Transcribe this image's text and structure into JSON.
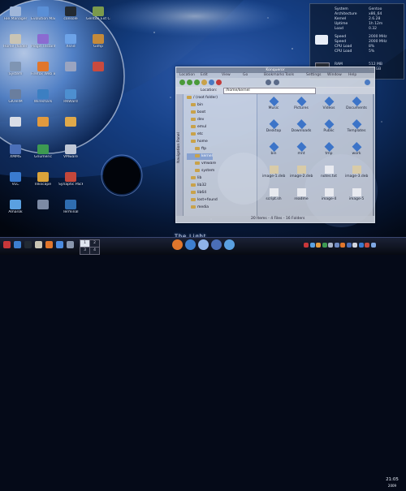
{
  "wallpaper_brand": "The Light",
  "desktop_icons": [
    {
      "label": "File Manager",
      "color": "#9fb6d9",
      "col": 0,
      "row": 0
    },
    {
      "label": "Evolution Mail",
      "color": "#5a8fd6",
      "col": 1,
      "row": 0
    },
    {
      "label": "console",
      "color": "#222a33",
      "col": 2,
      "row": 0
    },
    {
      "label": "Gentoo Ext Config",
      "color": "#7b9a4c",
      "col": 3,
      "row": 0
    },
    {
      "label": "Home (folder)",
      "color": "#c9c4b4",
      "col": 0,
      "row": 1
    },
    {
      "label": "Pidgin Instant Msgr",
      "color": "#8b6bd1",
      "col": 1,
      "row": 1
    },
    {
      "label": "Xsnd",
      "color": "#6da3e8",
      "col": 2,
      "row": 1
    },
    {
      "label": "Gimp",
      "color": "#c58a3a",
      "col": 3,
      "row": 1
    },
    {
      "label": "System",
      "color": "#7f95b3",
      "col": 0,
      "row": 2
    },
    {
      "label": "Firefox Web Browser",
      "color": "#e0762c",
      "col": 1,
      "row": 2
    },
    {
      "label": "",
      "color": "#9aa4c0",
      "col": 2,
      "row": 2
    },
    {
      "label": "",
      "color": "#c94a3e",
      "col": 3,
      "row": 2
    },
    {
      "label": "GKrellM",
      "color": "#6a7e9e",
      "col": 0,
      "row": 3
    },
    {
      "label": "Wireshark",
      "color": "#3c7fc2",
      "col": 1,
      "row": 3
    },
    {
      "label": "RKWard",
      "color": "#4d8fd0",
      "col": 2,
      "row": 3
    },
    {
      "label": "",
      "color": "#d9dde6",
      "col": 0,
      "row": 4
    },
    {
      "label": "",
      "color": "#e29a3e",
      "col": 1,
      "row": 4
    },
    {
      "label": "",
      "color": "#e0a94a",
      "col": 2,
      "row": 4
    },
    {
      "label": "XMMS",
      "color": "#4b6fb8",
      "col": 0,
      "row": 5
    },
    {
      "label": "Gnumeric",
      "color": "#3d9a52",
      "col": 1,
      "row": 5
    },
    {
      "label": "VMware",
      "color": "#bfc7d6",
      "col": 2,
      "row": 5
    },
    {
      "label": "VLC",
      "color": "#3a7bd0",
      "col": 0,
      "row": 6
    },
    {
      "label": "Inkscape",
      "color": "#d9a23a",
      "col": 1,
      "row": 6
    },
    {
      "label": "Synaptic Package Mgr",
      "color": "#c3473b",
      "col": 2,
      "row": 6
    },
    {
      "label": "Amarok",
      "color": "#5aa0e0",
      "col": 0,
      "row": 7
    },
    {
      "label": "",
      "color": "#7c8aa4",
      "col": 1,
      "row": 7
    },
    {
      "label": "Terminal",
      "color": "#2f6db0",
      "col": 2,
      "row": 7
    }
  ],
  "conky": {
    "rows": [
      {
        "label": "System",
        "value": "Gentoo"
      },
      {
        "label": "Architecture",
        "value": "x86_64"
      },
      {
        "label": "Kernel",
        "value": "2.6.28"
      },
      {
        "label": "Uptime",
        "value": "1h 12m"
      },
      {
        "label": "Load",
        "value": "0.32"
      }
    ],
    "cpu_rows": [
      {
        "label": "Speed",
        "value": "2000 MHz"
      },
      {
        "label": "Speed",
        "value": "2000 MHz"
      },
      {
        "label": "CPU Load",
        "value": "8%"
      },
      {
        "label": "CPU Load",
        "value": "5%"
      }
    ],
    "ram_rows": [
      {
        "label": "RAM",
        "value": "512 MB"
      },
      {
        "label": "Free",
        "value": "1.2 GB"
      }
    ]
  },
  "file_manager": {
    "title": "Konqueror",
    "menu": [
      "Location",
      "Edit",
      "View",
      "Go",
      "Bookmarks",
      "Tools",
      "Settings",
      "Window",
      "Help"
    ],
    "location_label": "Location:",
    "location_value": "/home/kernel",
    "sidebar_label": "Navigation Panel",
    "tree": [
      {
        "label": "/ (root folder)",
        "selected": false
      },
      {
        "label": "bin",
        "selected": false
      },
      {
        "label": "boot",
        "selected": false
      },
      {
        "label": "dev",
        "selected": false
      },
      {
        "label": "emul",
        "selected": false
      },
      {
        "label": "etc",
        "selected": false
      },
      {
        "label": "home",
        "selected": false
      },
      {
        "label": "ftp",
        "selected": false
      },
      {
        "label": "kernel",
        "selected": true
      },
      {
        "label": "vmware",
        "selected": false
      },
      {
        "label": "system",
        "selected": false
      },
      {
        "label": "lib",
        "selected": false
      },
      {
        "label": "lib32",
        "selected": false
      },
      {
        "label": "lib64",
        "selected": false
      },
      {
        "label": "lost+found",
        "selected": false
      },
      {
        "label": "media",
        "selected": false
      }
    ],
    "items": [
      {
        "label": "Music",
        "kind": "folder"
      },
      {
        "label": "Pictures",
        "kind": "folder"
      },
      {
        "label": "Videos",
        "kind": "folder"
      },
      {
        "label": "Documents",
        "kind": "folder"
      },
      {
        "label": "Desktop",
        "kind": "folder"
      },
      {
        "label": "Downloads",
        "kind": "folder"
      },
      {
        "label": "Public",
        "kind": "folder"
      },
      {
        "label": "Templates",
        "kind": "folder"
      },
      {
        "label": "bin",
        "kind": "folder"
      },
      {
        "label": "mnt",
        "kind": "folder"
      },
      {
        "label": "tmp",
        "kind": "folder"
      },
      {
        "label": "work",
        "kind": "folder"
      },
      {
        "label": "image-1.deb",
        "kind": "package"
      },
      {
        "label": "image-2.deb",
        "kind": "package"
      },
      {
        "label": "notes.txt",
        "kind": "file"
      },
      {
        "label": "image-3.deb",
        "kind": "package"
      },
      {
        "label": "script.sh",
        "kind": "file"
      },
      {
        "label": "readme",
        "kind": "file"
      },
      {
        "label": "image-4",
        "kind": "file"
      },
      {
        "label": "image-5",
        "kind": "file"
      }
    ],
    "status": "20 Items - 4 Files - 16 Folders"
  },
  "pager": [
    "1",
    "2",
    "3",
    "4"
  ],
  "clock": {
    "time": "21:05",
    "date": "2009"
  },
  "panel_icons": [
    {
      "name": "debian-menu-icon",
      "color": "#c8373a"
    },
    {
      "name": "show-desktop-icon",
      "color": "#3d7fd0"
    },
    {
      "name": "terminal-icon",
      "color": "#222a33"
    },
    {
      "name": "home-folder-icon",
      "color": "#c9c4b4"
    },
    {
      "name": "browser-icon",
      "color": "#e0762c"
    },
    {
      "name": "mail-icon",
      "color": "#4b8be0"
    },
    {
      "name": "settings-icon",
      "color": "#8a97ae"
    }
  ],
  "tray_icons": [
    "#c8373a",
    "#5aa0e0",
    "#e29a3e",
    "#3d9a52",
    "#aab4c8",
    "#6f8ac2",
    "#e0762c",
    "#4b6fb8",
    "#d0d4de",
    "#3a7bd0",
    "#c94a3e",
    "#7fa8e4"
  ]
}
